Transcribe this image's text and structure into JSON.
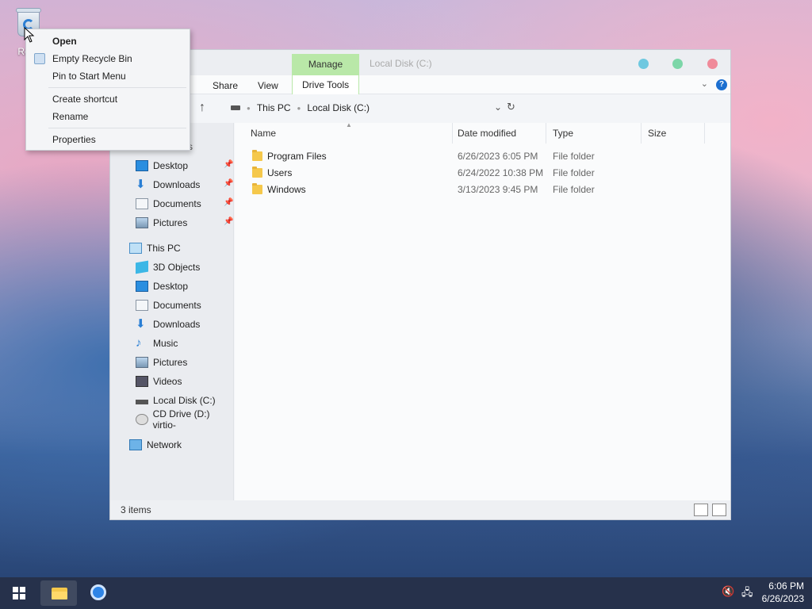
{
  "desktop": {
    "recycle_bin_label": "Recy"
  },
  "context_menu": {
    "items": [
      {
        "label": "Open"
      },
      {
        "label": "Empty Recycle Bin"
      },
      {
        "label": "Pin to Start Menu"
      },
      {
        "label": "Create shortcut"
      },
      {
        "label": "Rename"
      },
      {
        "label": "Properties"
      }
    ]
  },
  "explorer": {
    "title": "Local Disk (C:)",
    "contextual_tab_group": "Manage",
    "ribbon_tabs": [
      "Share",
      "View",
      "Drive Tools"
    ],
    "window_buttons": {
      "minimize_color": "#6ec8e0",
      "maximize_color": "#7cd6a8",
      "close_color": "#f08a9a"
    },
    "breadcrumb": [
      "This PC",
      "Local Disk (C:)"
    ],
    "nav": {
      "quick_access_partial": "ss",
      "quick_access": [
        {
          "label": "Desktop"
        },
        {
          "label": "Downloads"
        },
        {
          "label": "Documents"
        },
        {
          "label": "Pictures"
        }
      ],
      "this_pc": "This PC",
      "this_pc_items": [
        {
          "label": "3D Objects"
        },
        {
          "label": "Desktop"
        },
        {
          "label": "Documents"
        },
        {
          "label": "Downloads"
        },
        {
          "label": "Music"
        },
        {
          "label": "Pictures"
        },
        {
          "label": "Videos"
        },
        {
          "label": "Local Disk (C:)"
        },
        {
          "label": "CD Drive (D:) virtio-"
        }
      ],
      "network": "Network"
    },
    "columns": {
      "name": "Name",
      "date": "Date modified",
      "type": "Type",
      "size": "Size"
    },
    "files": [
      {
        "name": "Program Files",
        "date": "6/26/2023 6:05 PM",
        "type": "File folder"
      },
      {
        "name": "Users",
        "date": "6/24/2022 10:38 PM",
        "type": "File folder"
      },
      {
        "name": "Windows",
        "date": "3/13/2023 9:45 PM",
        "type": "File folder"
      }
    ],
    "status": "3 items"
  },
  "taskbar": {
    "time": "6:06 PM",
    "date": "6/26/2023"
  }
}
